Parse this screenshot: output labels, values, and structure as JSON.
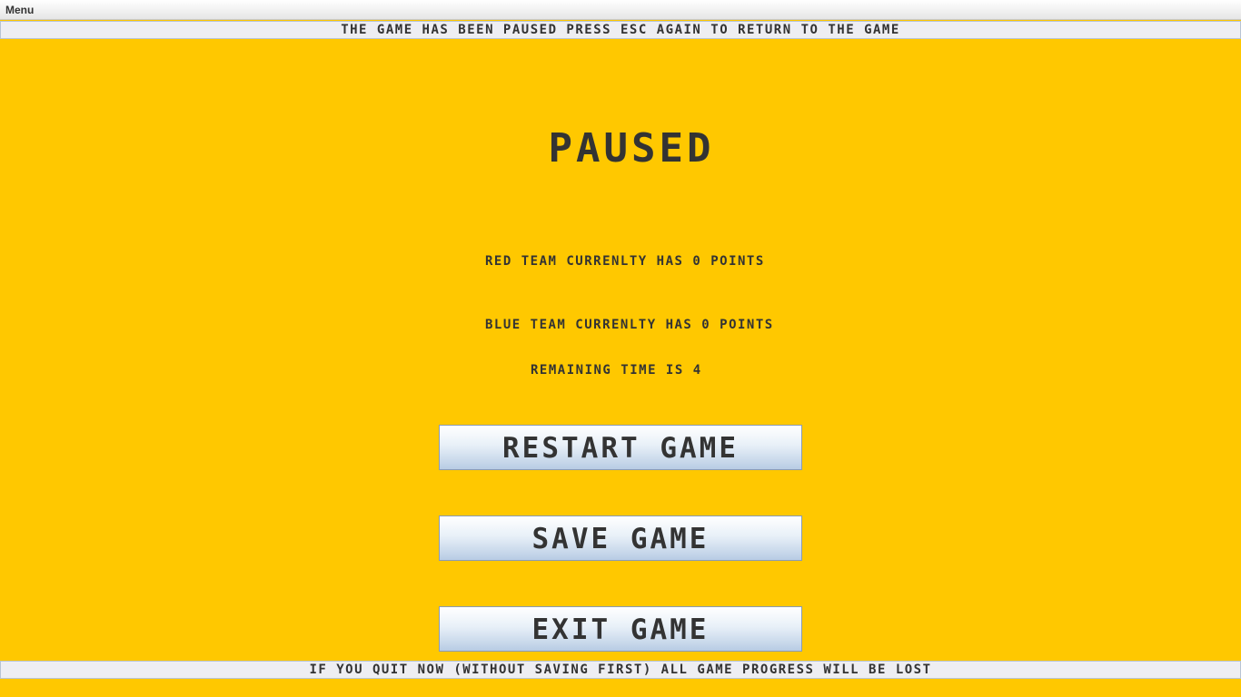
{
  "menubar": {
    "menu_label": "Menu"
  },
  "top_notice": "THE GAME HAS BEEN PAUSED PRESS ESC AGAIN TO RETURN TO THE GAME",
  "pause_screen": {
    "title": "PAUSED",
    "red_team_status": "RED TEAM CURRENLTY HAS 0 POINTS",
    "blue_team_status": "BLUE TEAM CURRENLTY HAS 0 POINTS",
    "remaining_time": "REMAINING TIME IS 4"
  },
  "buttons": {
    "restart_label": "RESTART GAME",
    "save_label": "SAVE GAME",
    "exit_label": "EXIT GAME"
  },
  "bottom_warning": "IF YOU QUIT NOW (WITHOUT SAVING FIRST) ALL GAME PROGRESS WILL BE LOST",
  "colors": {
    "background": "#ffc800",
    "text": "#333333"
  }
}
